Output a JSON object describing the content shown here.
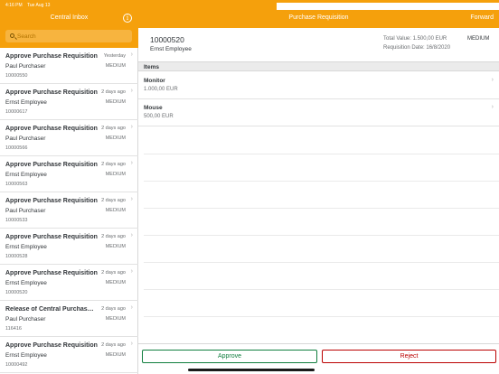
{
  "status_bar": {
    "time": "4:16 PM",
    "date": "Tue Aug 13",
    "battery": "100%"
  },
  "left_pane": {
    "title": "Central Inbox",
    "info_icon": "info-icon",
    "search_placeholder": "Search",
    "items": [
      {
        "title": "Approve Purchase Requisition",
        "when": "Yesterday",
        "who": "Paul Purchaser",
        "priority": "MEDIUM",
        "number": "10000550"
      },
      {
        "title": "Approve Purchase Requisition",
        "when": "2 days ago",
        "who": "Ernst Employee",
        "priority": "MEDIUM",
        "number": "10000617"
      },
      {
        "title": "Approve Purchase Requisition",
        "when": "2 days ago",
        "who": "Paul Purchaser",
        "priority": "MEDIUM",
        "number": "10000566"
      },
      {
        "title": "Approve Purchase Requisition",
        "when": "2 days ago",
        "who": "Ernst Employee",
        "priority": "MEDIUM",
        "number": "10000563"
      },
      {
        "title": "Approve Purchase Requisition",
        "when": "2 days ago",
        "who": "Paul Purchaser",
        "priority": "MEDIUM",
        "number": "10000533"
      },
      {
        "title": "Approve Purchase Requisition",
        "when": "2 days ago",
        "who": "Ernst Employee",
        "priority": "MEDIUM",
        "number": "10000528"
      },
      {
        "title": "Approve Purchase Requisition",
        "when": "2 days ago",
        "who": "Ernst Employee",
        "priority": "MEDIUM",
        "number": "10000520"
      },
      {
        "title": "Release of Central Purchase...",
        "when": "2 days ago",
        "who": "Paul Purchaser",
        "priority": "MEDIUM",
        "number": "116416"
      },
      {
        "title": "Approve Purchase Requisition",
        "when": "2 days ago",
        "who": "Ernst Employee",
        "priority": "MEDIUM",
        "number": "10000492"
      }
    ]
  },
  "right_pane": {
    "title": "Purchase Requisition",
    "forward_label": "Forward",
    "object": {
      "id": "10000520",
      "requester": "Ernst Employee",
      "total_value": "Total Value: 1.500,00 EUR",
      "requisition_date": "Requisition Date: 16/8/2020",
      "priority": "MEDIUM"
    },
    "section_label": "Items",
    "line_items": [
      {
        "name": "Monitor",
        "value": "1.000,00 EUR"
      },
      {
        "name": "Mouse",
        "value": "500,00 EUR"
      }
    ],
    "approve_label": "Approve",
    "reject_label": "Reject"
  },
  "colors": {
    "shell": "#f5a00c",
    "approve": "#107e3e",
    "reject": "#bb0000"
  }
}
